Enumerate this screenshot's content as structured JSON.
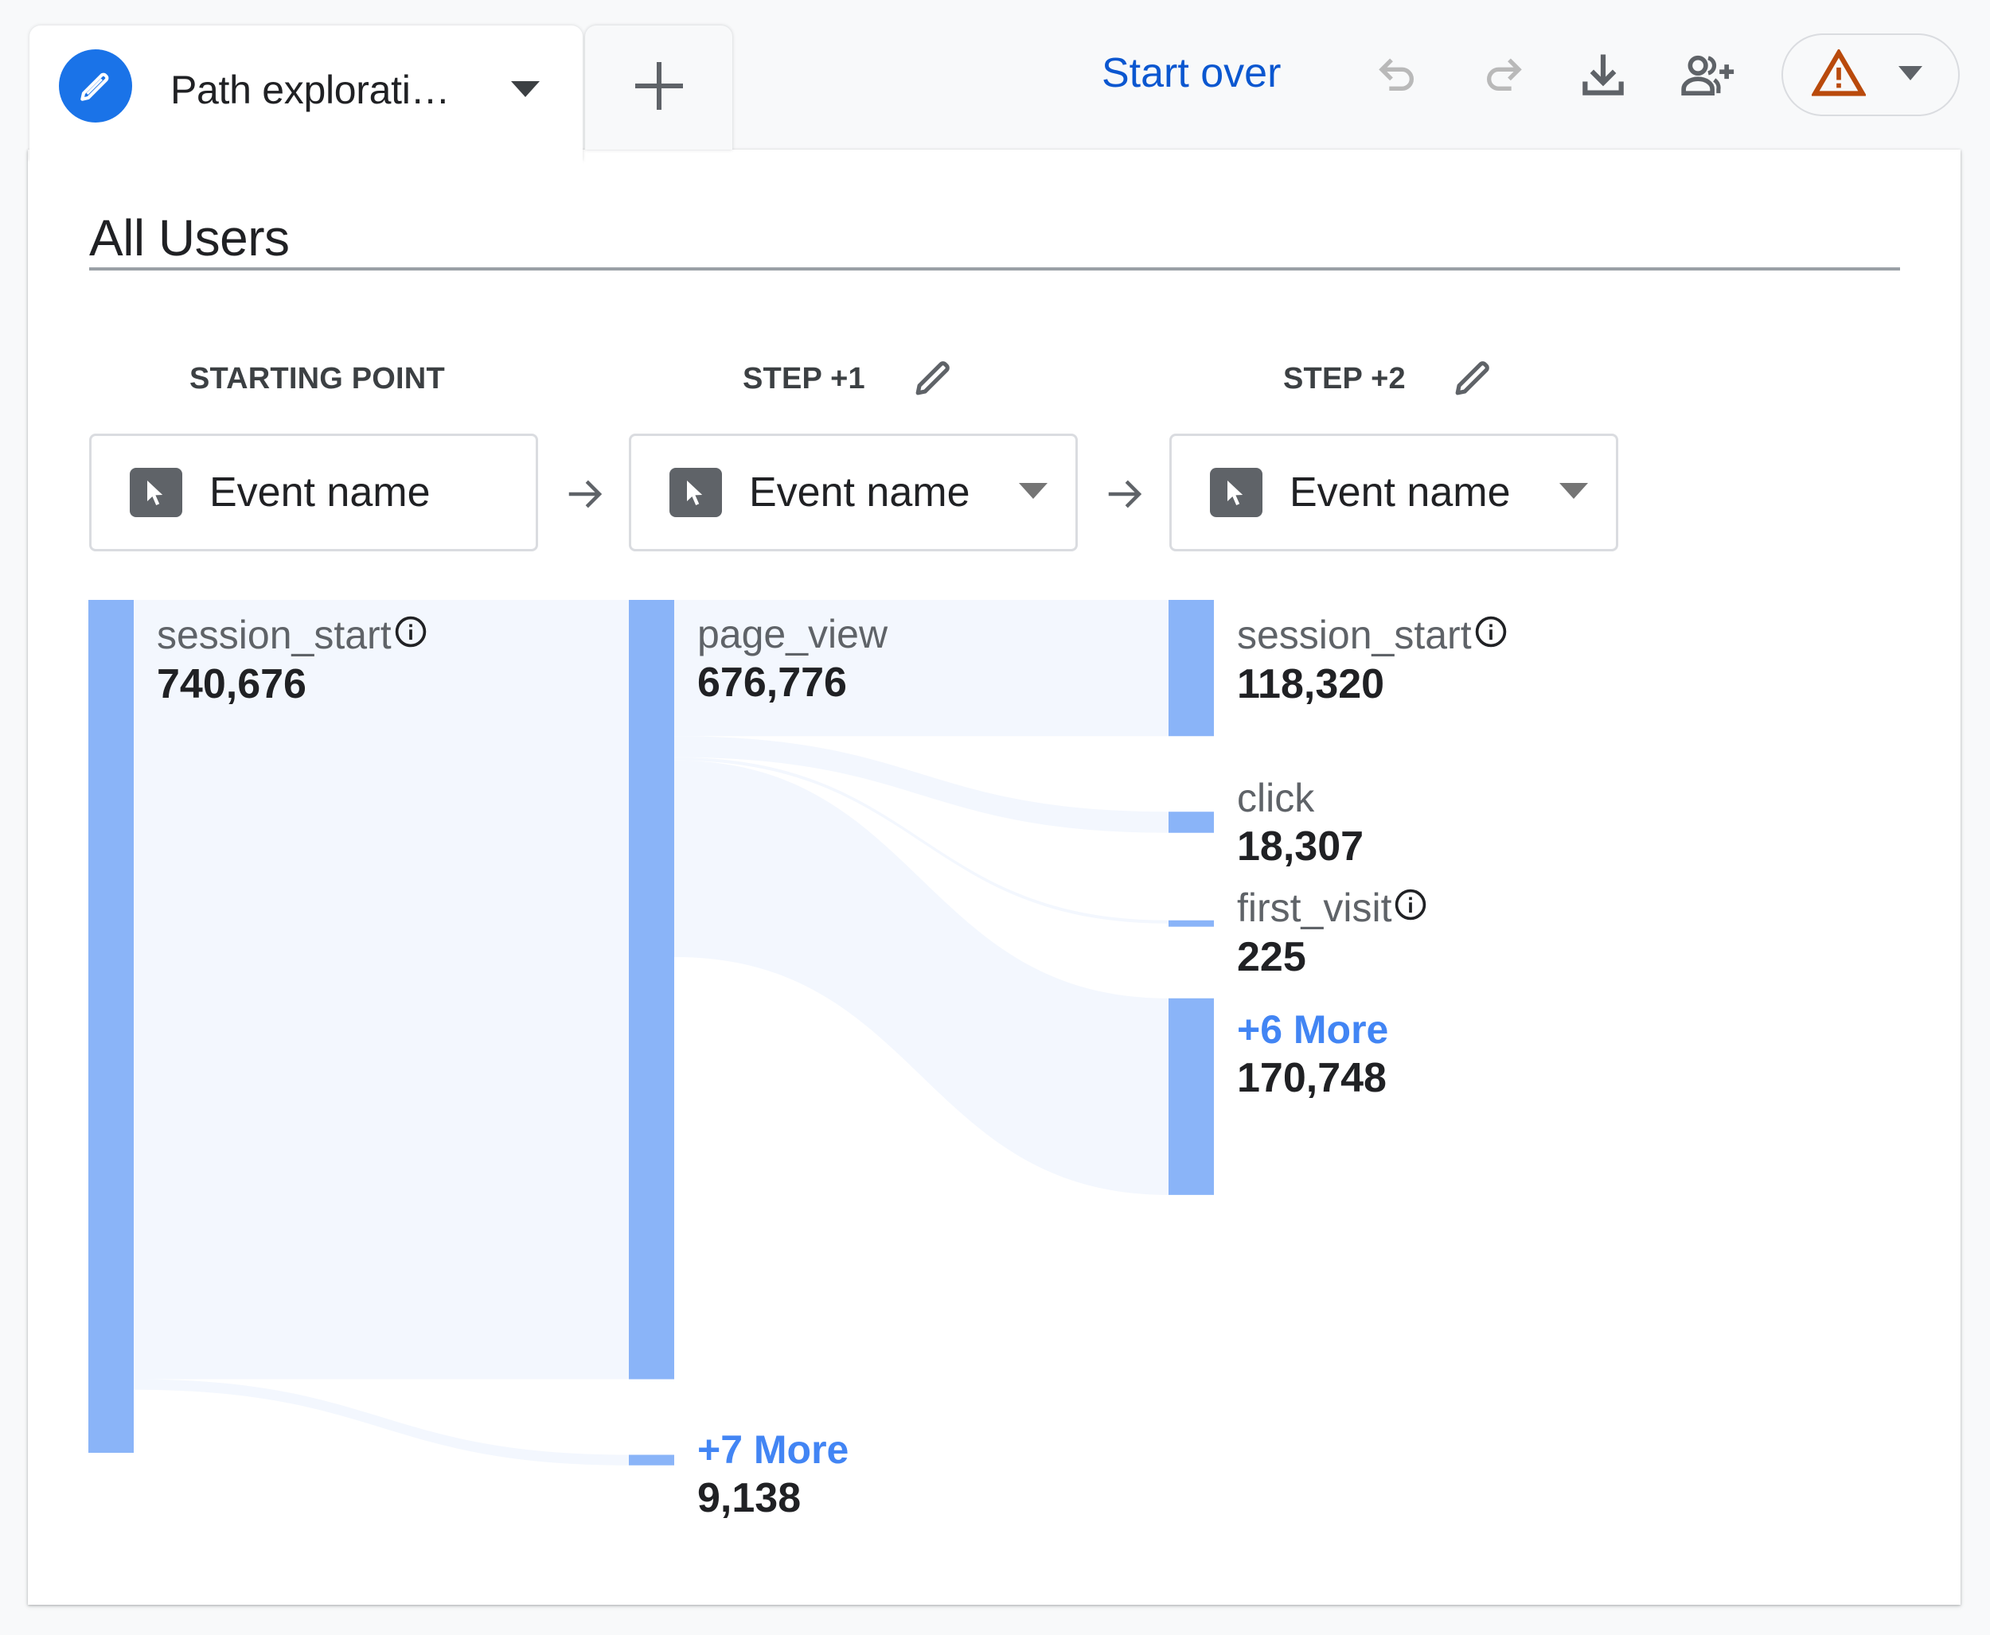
{
  "tabs": {
    "active": {
      "title": "Path explorati…",
      "icon": "pencil-icon"
    },
    "add": {
      "icon": "plus-icon"
    }
  },
  "toolbar": {
    "start_over": "Start over",
    "icons": [
      "undo-icon",
      "redo-icon",
      "download-icon",
      "share-user-icon",
      "warning-icon"
    ],
    "warning_color": "#b94a0c",
    "accent_color": "#0b57d0"
  },
  "segment": {
    "title": "All Users"
  },
  "steps": [
    {
      "label": "STARTING POINT",
      "editable": false,
      "dimension": "Event name",
      "has_dropdown": false
    },
    {
      "label": "STEP +1",
      "editable": true,
      "dimension": "Event name",
      "has_dropdown": true
    },
    {
      "label": "STEP +2",
      "editable": true,
      "dimension": "Event name",
      "has_dropdown": true
    }
  ],
  "chart_data": {
    "type": "sankey",
    "title": "All Users",
    "columns": [
      {
        "step": "STARTING POINT",
        "nodes": [
          {
            "name": "session_start",
            "value": "740,676",
            "value_num": 740676,
            "info": true,
            "more": false
          }
        ]
      },
      {
        "step": "STEP +1",
        "nodes": [
          {
            "name": "page_view",
            "value": "676,776",
            "value_num": 676776,
            "info": false,
            "more": false
          },
          {
            "name": "+7 More",
            "value": "9,138",
            "value_num": 9138,
            "info": false,
            "more": true
          }
        ]
      },
      {
        "step": "STEP +2",
        "nodes": [
          {
            "name": "session_start",
            "value": "118,320",
            "value_num": 118320,
            "info": true,
            "more": false
          },
          {
            "name": "click",
            "value": "18,307",
            "value_num": 18307,
            "info": false,
            "more": false
          },
          {
            "name": "first_visit",
            "value": "225",
            "value_num": 225,
            "info": true,
            "more": false
          },
          {
            "name": "+6 More",
            "value": "170,748",
            "value_num": 170748,
            "info": false,
            "more": true
          }
        ]
      }
    ],
    "links": [
      {
        "from": "session_start",
        "to": "page_view",
        "value": 676776
      },
      {
        "from": "session_start",
        "to": "+7 More",
        "value": 9138
      },
      {
        "from": "page_view",
        "to": "session_start",
        "value": 118320
      },
      {
        "from": "page_view",
        "to": "click",
        "value": 18307
      },
      {
        "from": "page_view",
        "to": "first_visit",
        "value": 225
      },
      {
        "from": "page_view",
        "to": "+6 More",
        "value": 170748
      }
    ],
    "colors": {
      "node": "#8ab4f8",
      "link": "#f3f7fe",
      "more_text": "#4285f4"
    }
  }
}
